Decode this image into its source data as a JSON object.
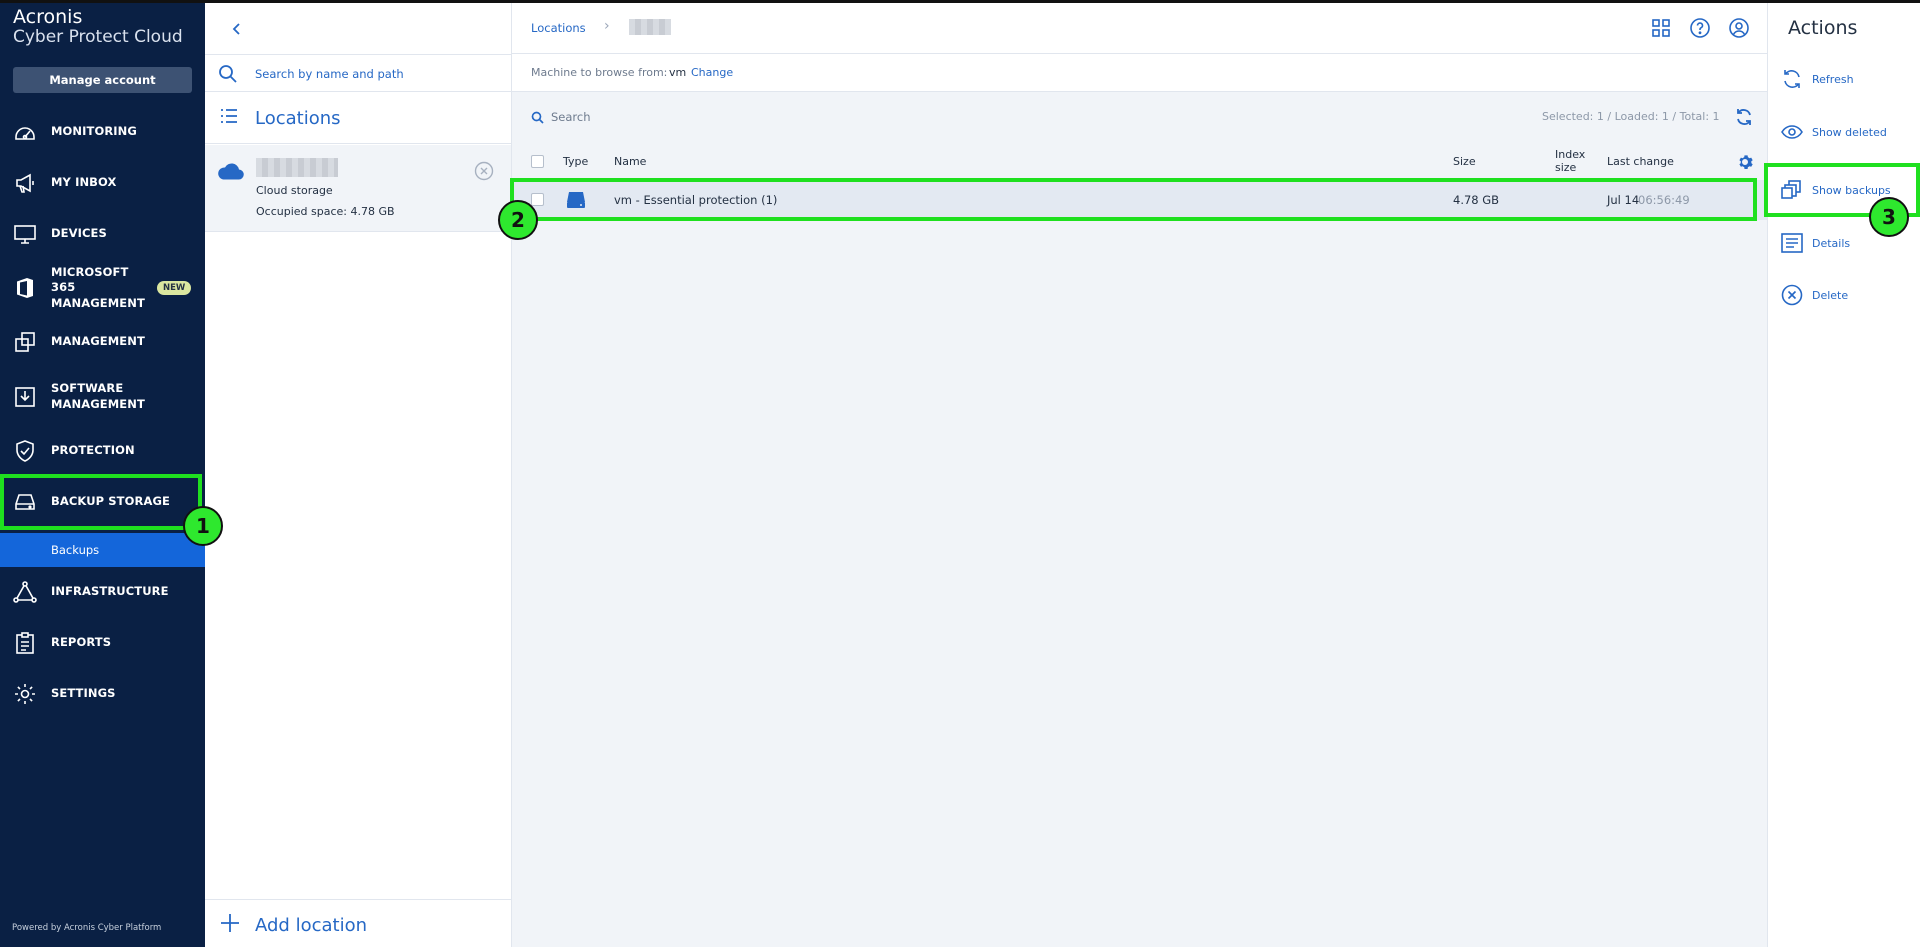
{
  "brand": {
    "line1": "Acronis",
    "line2": "Cyber Protect Cloud"
  },
  "sidebar": {
    "manage_account": "Manage account",
    "items": [
      {
        "label": "MONITORING",
        "icon": "monitoring-icon"
      },
      {
        "label": "MY INBOX",
        "icon": "megaphone-icon"
      },
      {
        "label": "DEVICES",
        "icon": "monitor-icon"
      },
      {
        "label": "MICROSOFT 365 MANAGEMENT",
        "icon": "office-icon",
        "badge": "NEW"
      },
      {
        "label": "MANAGEMENT",
        "icon": "management-icon"
      },
      {
        "label": "SOFTWARE MANAGEMENT",
        "icon": "software-icon"
      },
      {
        "label": "PROTECTION",
        "icon": "shield-icon"
      },
      {
        "label": "BACKUP STORAGE",
        "icon": "storage-icon"
      },
      {
        "label": "INFRASTRUCTURE",
        "icon": "infrastructure-icon"
      },
      {
        "label": "REPORTS",
        "icon": "reports-icon"
      },
      {
        "label": "SETTINGS",
        "icon": "gear-icon"
      }
    ],
    "sub_item": "Backups",
    "powered_by": "Powered by Acronis Cyber Platform"
  },
  "locations_panel": {
    "search_placeholder": "Search by name and path",
    "title": "Locations",
    "card": {
      "type": "Cloud storage",
      "occupied": "Occupied space: 4.78 GB"
    },
    "add_location": "Add location"
  },
  "main": {
    "breadcrumb": "Locations",
    "machine_label": "Machine to browse from:",
    "machine_value": "vm",
    "change_link": "Change",
    "search_placeholder": "Search",
    "counts": "Selected: 1 / Loaded: 1 / Total: 1",
    "columns": {
      "type": "Type",
      "name": "Name",
      "size": "Size",
      "index_size_1": "Index",
      "index_size_2": "size",
      "last_change": "Last change"
    },
    "rows": [
      {
        "name": "vm - Essential protection (1)",
        "size": "4.78 GB",
        "date": "Jul 14",
        "time": "06:56:49"
      }
    ]
  },
  "actions": {
    "title": "Actions",
    "items": [
      "Refresh",
      "Show deleted",
      "Show backups",
      "Details",
      "Delete"
    ]
  },
  "markers": [
    "1",
    "2",
    "3"
  ],
  "colors": {
    "sidebar_bg": "#0a2044",
    "accent": "#2668c5",
    "active": "#1466da",
    "highlight": "#1fe01f"
  }
}
